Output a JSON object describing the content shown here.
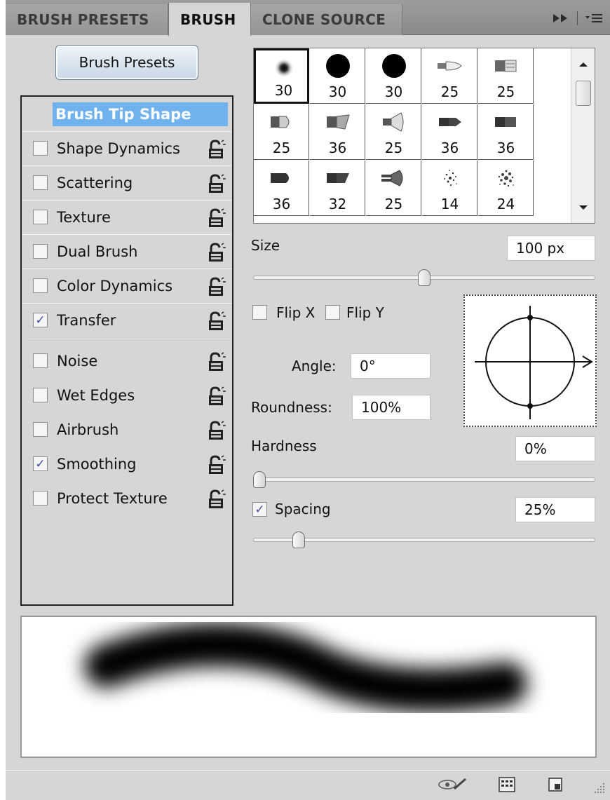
{
  "tabs": [
    {
      "label": "BRUSH PRESETS",
      "active": false
    },
    {
      "label": "BRUSH",
      "active": true
    },
    {
      "label": "CLONE SOURCE",
      "active": false
    }
  ],
  "tabbar_icons": [
    "fast-forward-icon",
    "panel-menu-icon"
  ],
  "presets_button": "Brush Presets",
  "left_panel": {
    "tip_shape": "Brush Tip Shape",
    "options": [
      {
        "label": "Shape Dynamics",
        "checked": false
      },
      {
        "label": "Scattering",
        "checked": false
      },
      {
        "label": "Texture",
        "checked": false
      },
      {
        "label": "Dual Brush",
        "checked": false
      },
      {
        "label": "Color Dynamics",
        "checked": false
      },
      {
        "label": "Transfer",
        "checked": true
      },
      {
        "label": "Noise",
        "checked": false
      },
      {
        "label": "Wet Edges",
        "checked": false
      },
      {
        "label": "Airbrush",
        "checked": false
      },
      {
        "label": "Smoothing",
        "checked": true
      },
      {
        "label": "Protect Texture",
        "checked": false
      }
    ]
  },
  "brush_grid": {
    "cells": [
      {
        "size": "30",
        "icon": "soft-round-brush-icon",
        "selected": true
      },
      {
        "size": "30",
        "icon": "hard-round-brush-icon"
      },
      {
        "size": "30",
        "icon": "hard-round-brush-icon"
      },
      {
        "size": "25",
        "icon": "bristle-brush-icon"
      },
      {
        "size": "25",
        "icon": "flat-bristle-brush-icon"
      },
      {
        "size": "25",
        "icon": "round-bristle-brush-icon"
      },
      {
        "size": "36",
        "icon": "fan-bristle-brush-icon"
      },
      {
        "size": "25",
        "icon": "cone-bristle-brush-icon"
      },
      {
        "size": "36",
        "icon": "point-bristle-brush-icon"
      },
      {
        "size": "36",
        "icon": "blunt-bristle-brush-icon"
      },
      {
        "size": "36",
        "icon": "round-blunt-brush-icon"
      },
      {
        "size": "32",
        "icon": "angle-flat-brush-icon"
      },
      {
        "size": "25",
        "icon": "fan-brush-icon"
      },
      {
        "size": "14",
        "icon": "spatter-brush-icon"
      },
      {
        "size": "24",
        "icon": "chalk-brush-icon"
      }
    ]
  },
  "size": {
    "label": "Size",
    "value": "100 px",
    "slider": 0.5
  },
  "flip_x": {
    "label": "Flip X",
    "checked": false
  },
  "flip_y": {
    "label": "Flip Y",
    "checked": false
  },
  "angle": {
    "label": "Angle:",
    "value": "0°"
  },
  "roundness": {
    "label": "Roundness:",
    "value": "100%"
  },
  "hardness": {
    "label": "Hardness",
    "value": "0%",
    "slider": 0.0
  },
  "spacing": {
    "label": "Spacing",
    "value": "25%",
    "checked": true,
    "slider": 0.12
  },
  "status_icons": [
    "eye-brush-icon",
    "grid-panel-icon",
    "new-preset-icon",
    "resize-grip-icon"
  ]
}
